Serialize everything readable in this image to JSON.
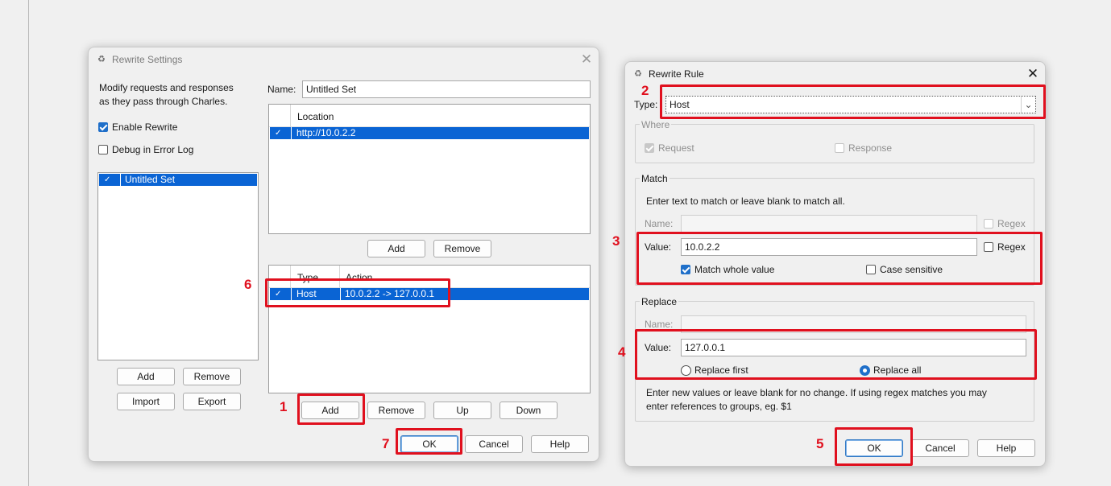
{
  "rewrite_settings": {
    "title": "Rewrite Settings",
    "description_line1": "Modify requests and responses",
    "description_line2": "as they pass through Charles.",
    "enable_rewrite": "Enable Rewrite",
    "debug_error_log": "Debug in Error Log",
    "sets": [
      {
        "name": "Untitled Set",
        "checked": true
      }
    ],
    "set_buttons": {
      "add": "Add",
      "remove": "Remove",
      "import": "Import",
      "export": "Export"
    },
    "name_label": "Name:",
    "name_value": "Untitled Set",
    "locations_header": "Location",
    "locations": [
      {
        "value": "http://10.0.2.2",
        "checked": true
      }
    ],
    "location_buttons": {
      "add": "Add",
      "remove": "Remove"
    },
    "rules_headers": {
      "type": "Type",
      "action": "Action"
    },
    "rules": [
      {
        "type": "Host",
        "action": "10.0.2.2 -> 127.0.0.1",
        "checked": true
      }
    ],
    "rule_buttons": {
      "add": "Add",
      "remove": "Remove",
      "up": "Up",
      "down": "Down"
    },
    "footer": {
      "ok": "OK",
      "cancel": "Cancel",
      "help": "Help"
    }
  },
  "rewrite_rule": {
    "title": "Rewrite Rule",
    "type_label": "Type:",
    "type_value": "Host",
    "where": {
      "title": "Where",
      "request": "Request",
      "response": "Response"
    },
    "match": {
      "title": "Match",
      "hint": "Enter text to match or leave blank to match all.",
      "name_label": "Name:",
      "name_regex": "Regex",
      "value_label": "Value:",
      "value": "10.0.2.2",
      "value_regex": "Regex",
      "match_whole_value": "Match whole value",
      "case_sensitive": "Case sensitive"
    },
    "replace": {
      "title": "Replace",
      "name_label": "Name:",
      "value_label": "Value:",
      "value": "127.0.0.1",
      "replace_first": "Replace first",
      "replace_all": "Replace all",
      "hint_line1": "Enter new values or leave blank for no change. If using regex matches you may",
      "hint_line2": "enter references to groups, eg. $1"
    },
    "footer": {
      "ok": "OK",
      "cancel": "Cancel",
      "help": "Help"
    }
  },
  "steps": {
    "s1": "1",
    "s2": "2",
    "s3": "3",
    "s4": "4",
    "s5": "5",
    "s6": "6",
    "s7": "7"
  },
  "colors": {
    "highlight": "#e0101e",
    "selection": "#0a64d4",
    "accent": "#1f6fc9"
  }
}
